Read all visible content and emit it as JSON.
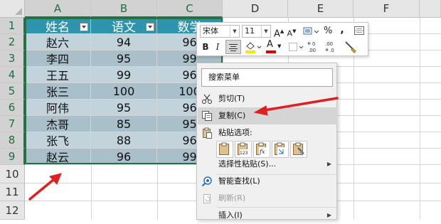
{
  "spreadsheet": {
    "columns": [
      "A",
      "B",
      "C",
      "D",
      "E",
      "F"
    ],
    "rows": [
      "1",
      "2",
      "3",
      "4",
      "5",
      "6",
      "7",
      "8",
      "9",
      "10",
      "11",
      "12"
    ],
    "headers": [
      "姓名",
      "语文",
      "数学"
    ],
    "records": [
      [
        "赵六",
        "94",
        "96"
      ],
      [
        "李四",
        "95",
        "99"
      ],
      [
        "王五",
        "99",
        "96"
      ],
      [
        "张三",
        "100",
        "100"
      ],
      [
        "阿伟",
        "95",
        "96"
      ],
      [
        "杰哥",
        "85",
        "95"
      ],
      [
        "张飞",
        "88",
        "96"
      ],
      [
        "赵云",
        "96",
        "99"
      ]
    ]
  },
  "mini_toolbar": {
    "font_name": "宋体",
    "font_size": "11",
    "grow": "A",
    "shrink": "A",
    "percent": "%",
    "comma": ",",
    "bold": "B",
    "italic": "I",
    "font_color_letter": "A",
    "inc_decimal": ".00",
    "dec_decimal": ".0",
    "fill_color": "#ffe600",
    "font_color": "#e00000"
  },
  "context_menu": {
    "search_placeholder": "搜索菜单",
    "items": [
      {
        "label": "剪切(T)",
        "icon": "scissors-icon"
      },
      {
        "label": "复制(C)",
        "icon": "copy-icon"
      },
      {
        "label": "粘贴选项:",
        "icon": "clipboard-icon"
      },
      {
        "label": "选择性粘贴(S)...",
        "icon": ""
      },
      {
        "label": "智能查找(L)",
        "icon": "smart-lookup-icon"
      },
      {
        "label": "刷新(R)",
        "icon": "refresh-icon"
      },
      {
        "label": "插入(I)",
        "icon": ""
      }
    ],
    "paste_options": [
      "paste-icon",
      "paste-values-icon",
      "paste-formulas-icon",
      "paste-transpose-icon",
      "paste-formatting-icon"
    ]
  },
  "colors": {
    "header_fill": "#2e93ad",
    "band_light": "#c2d3dc",
    "band_dark": "#a9bfc9",
    "selection": "#217346",
    "arrow": "#e02020"
  }
}
